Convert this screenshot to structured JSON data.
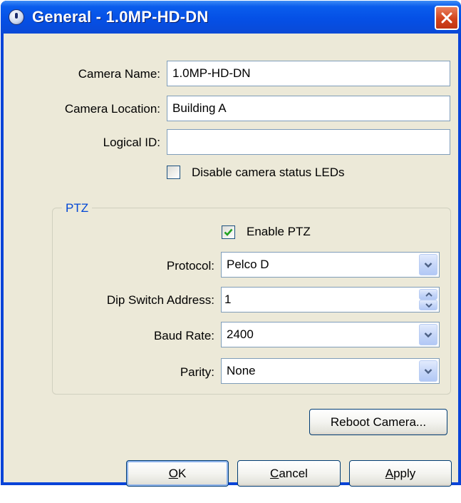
{
  "window": {
    "title": "General - 1.0MP-HD-DN",
    "icon": "camera-app-icon"
  },
  "fields": {
    "camera_name": {
      "label": "Camera Name:",
      "value": "1.0MP-HD-DN"
    },
    "camera_location": {
      "label": "Camera Location:",
      "value": "Building A"
    },
    "logical_id": {
      "label": "Logical ID:",
      "value": ""
    }
  },
  "disable_leds": {
    "label": "Disable camera status LEDs",
    "checked": false
  },
  "ptz": {
    "group_title": "PTZ",
    "enable": {
      "label": "Enable PTZ",
      "checked": true
    },
    "protocol": {
      "label": "Protocol:",
      "value": "Pelco D"
    },
    "dip_switch": {
      "label": "Dip Switch Address:",
      "value": "1"
    },
    "baud_rate": {
      "label": "Baud Rate:",
      "value": "2400"
    },
    "parity": {
      "label": "Parity:",
      "value": "None"
    }
  },
  "buttons": {
    "reboot": "Reboot Camera...",
    "ok_accel": "O",
    "ok_rest": "K",
    "cancel_accel": "C",
    "cancel_rest": "ancel",
    "apply_accel": "A",
    "apply_rest": "pply"
  }
}
